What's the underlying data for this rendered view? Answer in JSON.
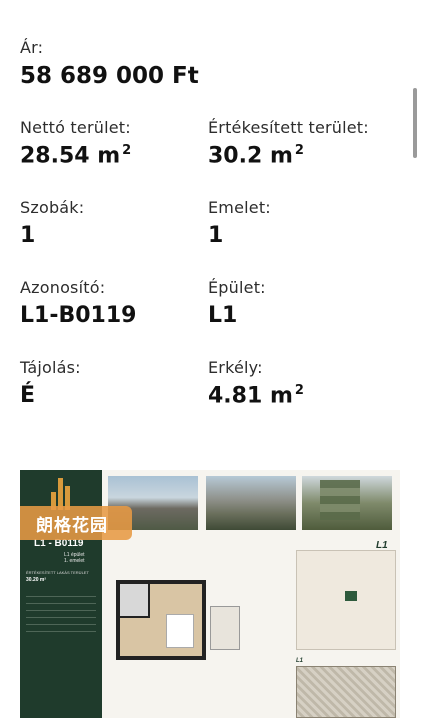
{
  "price": {
    "label": "Ár:",
    "value": "58 689 000 Ft"
  },
  "specs": [
    {
      "label": "Nettó terület:",
      "value": "28.54 m",
      "unit_sup": "2"
    },
    {
      "label": "Értékesített terület:",
      "value": "30.2 m",
      "unit_sup": "2"
    },
    {
      "label": "Szobák:",
      "value": "1"
    },
    {
      "label": "Emelet:",
      "value": "1"
    },
    {
      "label": "Azonosító:",
      "value": "L1-B0119"
    },
    {
      "label": "Épület:",
      "value": "L1"
    },
    {
      "label": "Tájolás:",
      "value": "É"
    },
    {
      "label": "Erkély:",
      "value": "4.81 m",
      "unit_sup": "2"
    }
  ],
  "brochure": {
    "watermark": "朗格花园",
    "unit_code": "L1 - B0119",
    "unit_floor_1": "L1 épület",
    "unit_floor_2": "1. emelet",
    "area_label": "ÉRTÉKESÍTETT LAKÁS TERÜLET",
    "area_value": "30.20 m²",
    "building_label": "L1",
    "building_label_small": "L1"
  },
  "colors": {
    "brochure_green": "#1f3b2c",
    "logo_orange": "#d89a3c",
    "watermark_orange": "#e79a44"
  }
}
